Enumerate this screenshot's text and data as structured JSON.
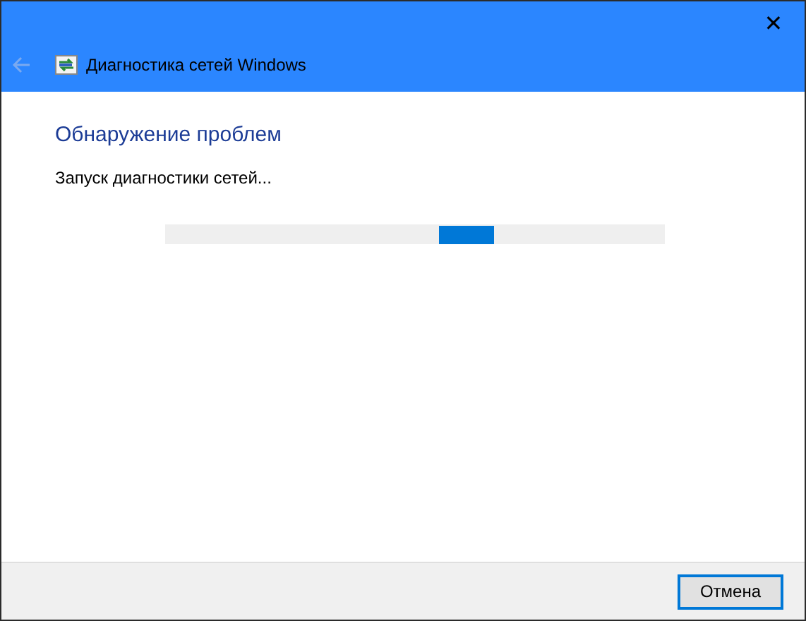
{
  "window": {
    "title": "Диагностика сетей Windows",
    "close": "✕",
    "back_disabled": true
  },
  "heading": "Обнаружение проблем",
  "status": "Запуск диагностики сетей...",
  "progress": {
    "kind": "marquee"
  },
  "buttons": [
    {
      "label": "Отмена",
      "default": true
    }
  ]
}
